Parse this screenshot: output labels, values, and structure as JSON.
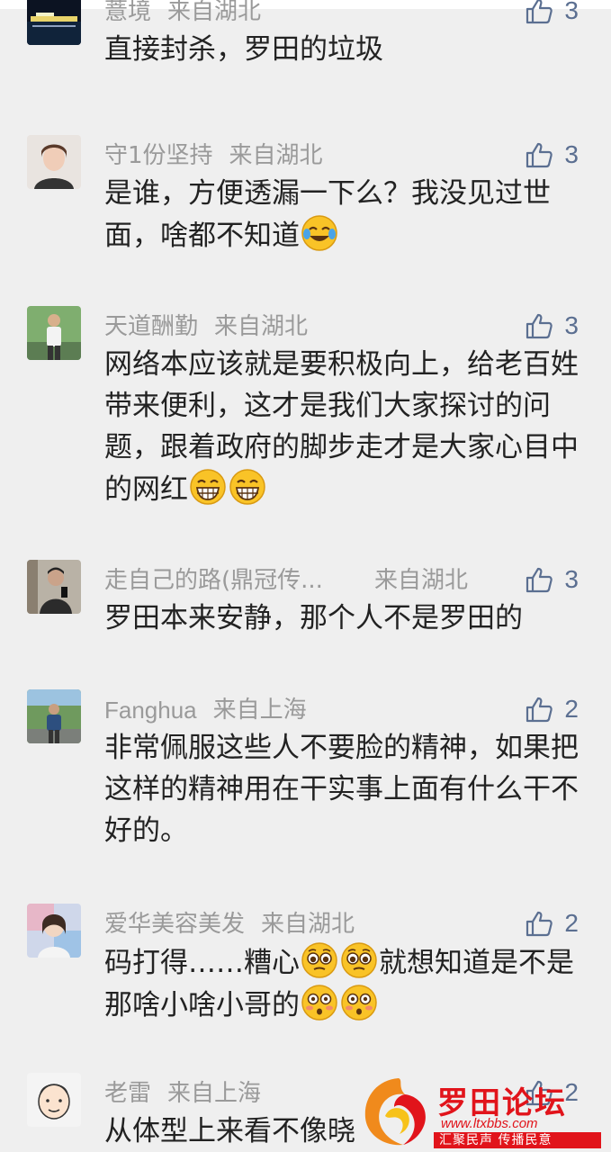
{
  "colors": {
    "like_icon": "#5b6f91",
    "meta": "#9a9a9a",
    "text": "#222222",
    "background": "#efefef",
    "watermark": "#e1141b"
  },
  "comments": [
    {
      "name": "薏境",
      "location": "来自湖北",
      "likes": "3",
      "parts": [
        "直接封杀，罗田的垃圾"
      ],
      "avatar_icon": "night-river-scene-avatar"
    },
    {
      "name": "守1份坚持",
      "location": "来自湖北",
      "likes": "3",
      "parts": [
        "是谁，方便透漏一下么？我没见过世面，啥都不知道"
      ],
      "emojis": [
        "face-with-tears-of-joy-emoji"
      ],
      "avatar_icon": "woman-portrait-avatar"
    },
    {
      "name": "天道酬勤",
      "location": "来自湖北",
      "likes": "3",
      "parts": [
        "网络本应该就是要积极向上，给老百姓带来便利，这才是我们大家探讨的问题，跟着政府的脚步走才是大家心目中的网红"
      ],
      "emojis": [
        "grinning-face-emoji",
        "grinning-face-emoji"
      ],
      "avatar_icon": "man-standing-avatar"
    },
    {
      "name": "走自己的路(鼎冠传...",
      "location": "来自湖北",
      "likes": "3",
      "parts": [
        "罗田本来安静，那个人不是罗田的"
      ],
      "avatar_icon": "man-selfie-avatar"
    },
    {
      "name": "Fanghua",
      "location": "来自上海",
      "likes": "2",
      "parts": [
        "非常佩服这些人不要脸的精神，如果把这样的精神用在干实事上面有什么干不好的。"
      ],
      "avatar_icon": "man-outdoor-avatar"
    },
    {
      "name": "爱华美容美发",
      "location": "来自湖北",
      "likes": "2",
      "parts": [
        "码打得……糟心",
        "就想知道是不是那啥小啥小哥的"
      ],
      "emojis": [
        "pleading-face-emoji",
        "pleading-face-emoji",
        "flushed-face-emoji",
        "flushed-face-emoji"
      ],
      "avatar_icon": "colorful-portrait-avatar"
    },
    {
      "name": "老雷",
      "location": "来自上海",
      "likes": "2",
      "parts": [
        "从体型上来看不像晓"
      ],
      "avatar_icon": "cartoon-man-avatar"
    }
  ],
  "watermark": {
    "title": "罗田论坛",
    "url": "www.ltxbbs.com",
    "slogan": "汇聚民声 传播民意"
  }
}
